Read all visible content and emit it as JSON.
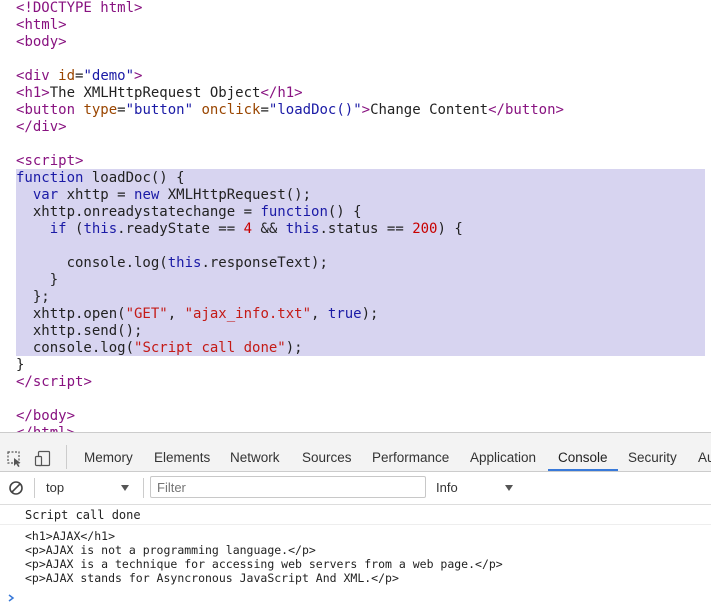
{
  "code": {
    "l01": "<!DOCTYPE html>",
    "l02_open": "<",
    "l02_tag": "html",
    "l02_close": ">",
    "l03_open": "<",
    "l03_tag": "body",
    "l03_close": ">",
    "l05_a": "<",
    "l05_tag": "div",
    "l05_attr": " id",
    "l05_eq": "=",
    "l05_val": "\"demo\"",
    "l05_b": ">",
    "l06_a": "<",
    "l06_tag": "h1",
    "l06_b": ">",
    "l06_text": "The XMLHttpRequest Object",
    "l06_c": "</",
    "l06_tag2": "h1",
    "l06_d": ">",
    "l07_a": "<",
    "l07_tag": "button",
    "l07_attr1": " type",
    "l07_eq1": "=",
    "l07_val1": "\"button\"",
    "l07_attr2": " onclick",
    "l07_eq2": "=",
    "l07_val2": "\"loadDoc()\"",
    "l07_b": ">",
    "l07_text": "Change Content",
    "l07_c": "</",
    "l07_tag2": "button",
    "l07_d": ">",
    "l08_a": "</",
    "l08_tag": "div",
    "l08_b": ">",
    "l10_a": "<",
    "l10_tag": "script",
    "l10_b": ">",
    "l11_kw": "function",
    "l11_rest": " loadDoc() {",
    "l12_pre": "  ",
    "l12_kw": "var",
    "l12_mid": " xhttp = ",
    "l12_kw2": "new",
    "l12_rest": " XMLHttpRequest();",
    "l13_pre": "  xhttp.onreadystatechange = ",
    "l13_kw": "function",
    "l13_rest": "() {",
    "l14_pre": "    ",
    "l14_kw": "if",
    "l14_a": " (",
    "l14_this1": "this",
    "l14_b": ".readyState == ",
    "l14_n1": "4",
    "l14_c": " && ",
    "l14_this2": "this",
    "l14_d": ".status == ",
    "l14_n2": "200",
    "l14_e": ") {",
    "l16_pre": "      console.log(",
    "l16_this": "this",
    "l16_rest": ".responseText);",
    "l17": "    }",
    "l18": "  };",
    "l19_pre": "  xhttp.open(",
    "l19_s1": "\"GET\"",
    "l19_c1": ", ",
    "l19_s2": "\"ajax_info.txt\"",
    "l19_c2": ", ",
    "l19_kw": "true",
    "l19_end": ");",
    "l20": "  xhttp.send();",
    "l21_pre": "  console.log(",
    "l21_str": "\"Script call done\"",
    "l21_end": ");",
    "l22": "}",
    "l23_a": "</",
    "l23_tag": "script",
    "l23_b": ">",
    "l25_a": "</",
    "l25_tag": "body",
    "l25_b": ">",
    "l26_a": "</",
    "l26_tag": "html",
    "l26_b": ">"
  },
  "devtools": {
    "tabs": [
      "Memory",
      "Elements",
      "Network",
      "Sources",
      "Performance",
      "Application",
      "Console",
      "Security",
      "Au"
    ],
    "context": "top",
    "filter_placeholder": "Filter",
    "level": "Info"
  },
  "console": {
    "lines": [
      "Script call done",
      "<h1>AJAX</h1>",
      "<p>AJAX is not a programming language.</p>",
      "<p>AJAX is a technique for accessing web servers from a web page.</p>",
      "<p>AJAX stands for Asyncronous JavaScript And XML.</p>"
    ]
  },
  "icons": {
    "inspect": "inspect-element-icon",
    "device": "device-toolbar-icon",
    "clear": "clear-console-icon",
    "dropdown": "chevron-down-icon"
  },
  "colors": {
    "selection": "#d7d4f0",
    "active_tab_underline": "#3879d9"
  }
}
